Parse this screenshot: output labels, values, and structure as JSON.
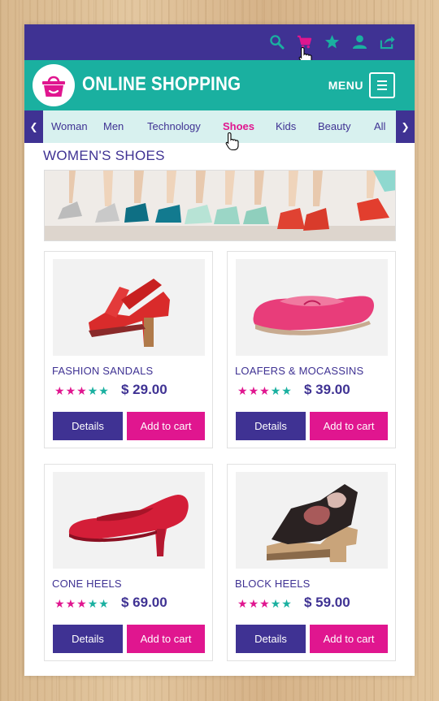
{
  "top_icons": [
    "search-icon",
    "cart-icon",
    "star-icon",
    "user-icon",
    "share-icon"
  ],
  "header": {
    "brand": "ONLINE SHOPPING",
    "menu_label": "MENU"
  },
  "nav": {
    "categories": [
      "Woman",
      "Men",
      "Technology",
      "Shoes",
      "Kids",
      "Beauty",
      "All"
    ],
    "active": "Shoes"
  },
  "section_title": "WOMEN'S SHOES",
  "products": [
    {
      "name": "FASHION SANDALS",
      "price": "$ 29.00",
      "rating": 5
    },
    {
      "name": "LOAFERS & MOCASSINS",
      "price": "$ 39.00",
      "rating": 5
    },
    {
      "name": "CONE HEELS",
      "price": "$ 69.00",
      "rating": 5
    },
    {
      "name": "BLOCK HEELS",
      "price": "$ 59.00",
      "rating": 5
    }
  ],
  "buttons": {
    "details": "Details",
    "add_to_cart": "Add to cart"
  },
  "colors": {
    "primary": "#3f3293",
    "accent": "#e0168f",
    "teal": "#1ab0a0",
    "nav_bg": "#d8f1ef"
  }
}
